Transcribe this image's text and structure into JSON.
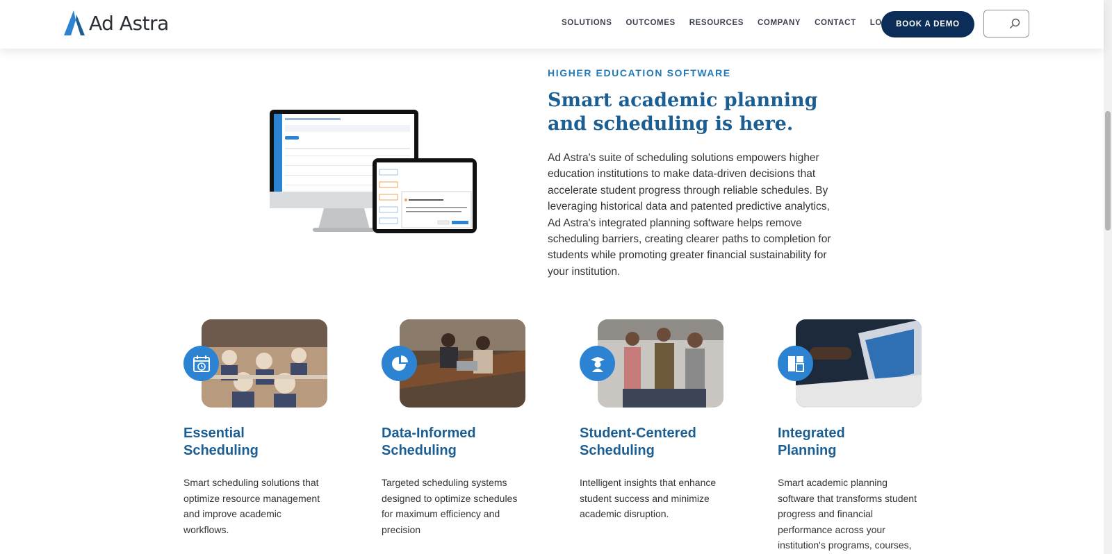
{
  "header": {
    "brand": "Ad Astra",
    "nav": [
      "SOLUTIONS",
      "OUTCOMES",
      "RESOURCES",
      "COMPANY",
      "CONTACT",
      "LOG IN"
    ],
    "cta": "BOOK A DEMO",
    "search_icon": "search-icon"
  },
  "colors": {
    "navy": "#0b2d57",
    "blue": "#1b5e93",
    "accent": "#2c83d2",
    "eyebrow": "#1f79b9"
  },
  "hero": {
    "eyebrow": "HIGHER EDUCATION SOFTWARE",
    "title": "Smart academic planning and scheduling is here.",
    "body": "Ad Astra's suite of scheduling solutions empowers higher education institutions to make data-driven decisions that accelerate student progress through reliable schedules. By leveraging historical data and patented predictive analytics, Ad Astra's integrated planning software helps remove scheduling barriers, creating clearer paths to completion for students while promoting greater financial sustainability for your institution."
  },
  "cards": [
    {
      "title_line1": "Essential",
      "title_line2": "Scheduling",
      "desc": "Smart scheduling solutions that optimize resource management and improve academic workflows.",
      "icon": "calendar-clock-icon"
    },
    {
      "title_line1": "Data-Informed",
      "title_line2": "Scheduling",
      "desc": "Targeted scheduling systems designed to optimize schedules for maximum efficiency and precision",
      "icon": "pie-chart-icon"
    },
    {
      "title_line1": "Student-Centered",
      "title_line2": "Scheduling",
      "desc": "Intelligent insights that enhance student success and minimize academic disruption.",
      "icon": "graduate-icon"
    },
    {
      "title_line1": "Integrated",
      "title_line2": "Planning",
      "desc": "Smart academic planning software that transforms student progress and financial performance across your institution's programs, courses, and faculty.",
      "icon": "dashboard-layout-icon"
    }
  ]
}
